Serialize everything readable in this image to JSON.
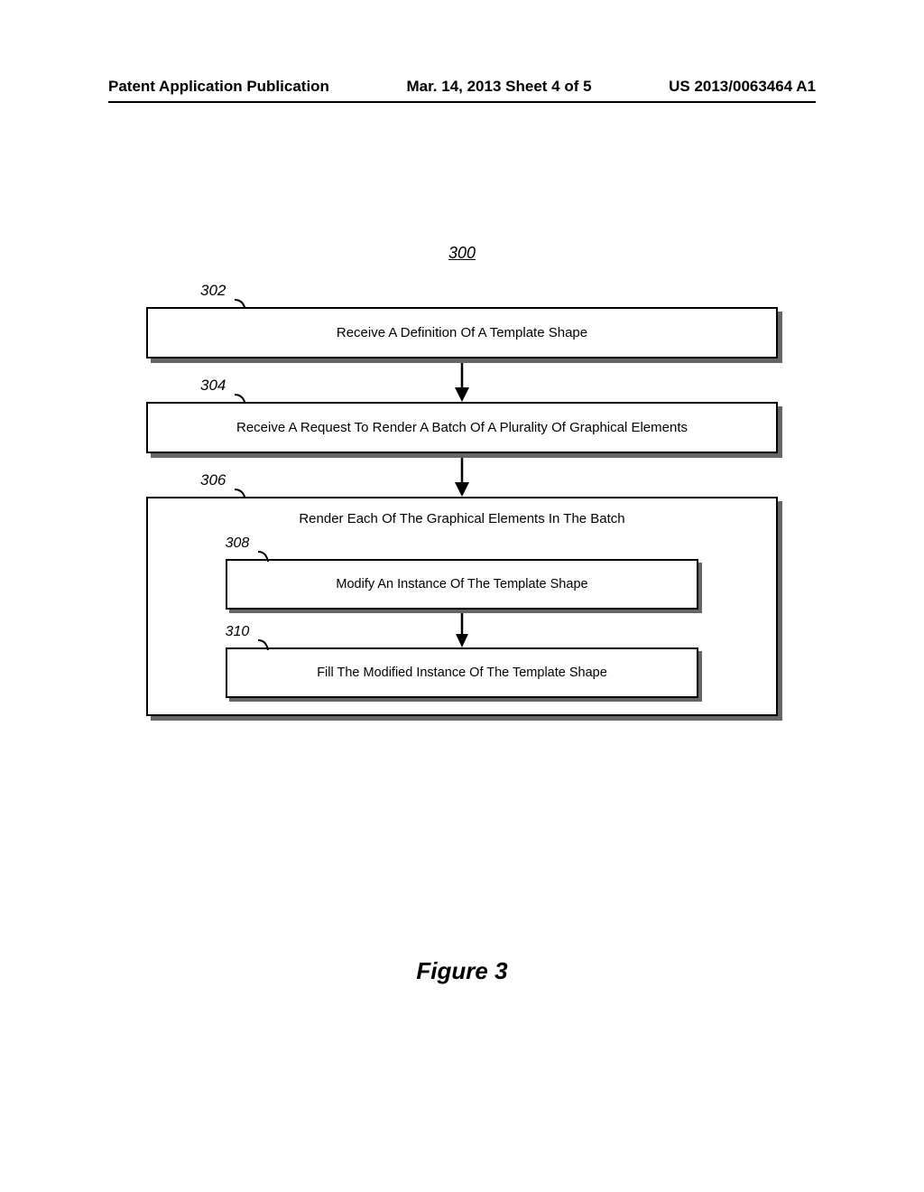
{
  "header": {
    "left": "Patent Application Publication",
    "center": "Mar. 14, 2013  Sheet 4 of 5",
    "right": "US 2013/0063464 A1"
  },
  "flowchart": {
    "ref": "300",
    "steps": [
      {
        "ref": "302",
        "text": "Receive A Definition Of A Template Shape"
      },
      {
        "ref": "304",
        "text": "Receive A Request To Render A Batch Of A Plurality Of Graphical Elements"
      },
      {
        "ref": "306",
        "text": "Render Each Of The Graphical Elements In The Batch",
        "substeps": [
          {
            "ref": "308",
            "text": "Modify An Instance Of The Template Shape"
          },
          {
            "ref": "310",
            "text": "Fill The Modified Instance Of The Template Shape"
          }
        ]
      }
    ]
  },
  "caption": "Figure 3"
}
